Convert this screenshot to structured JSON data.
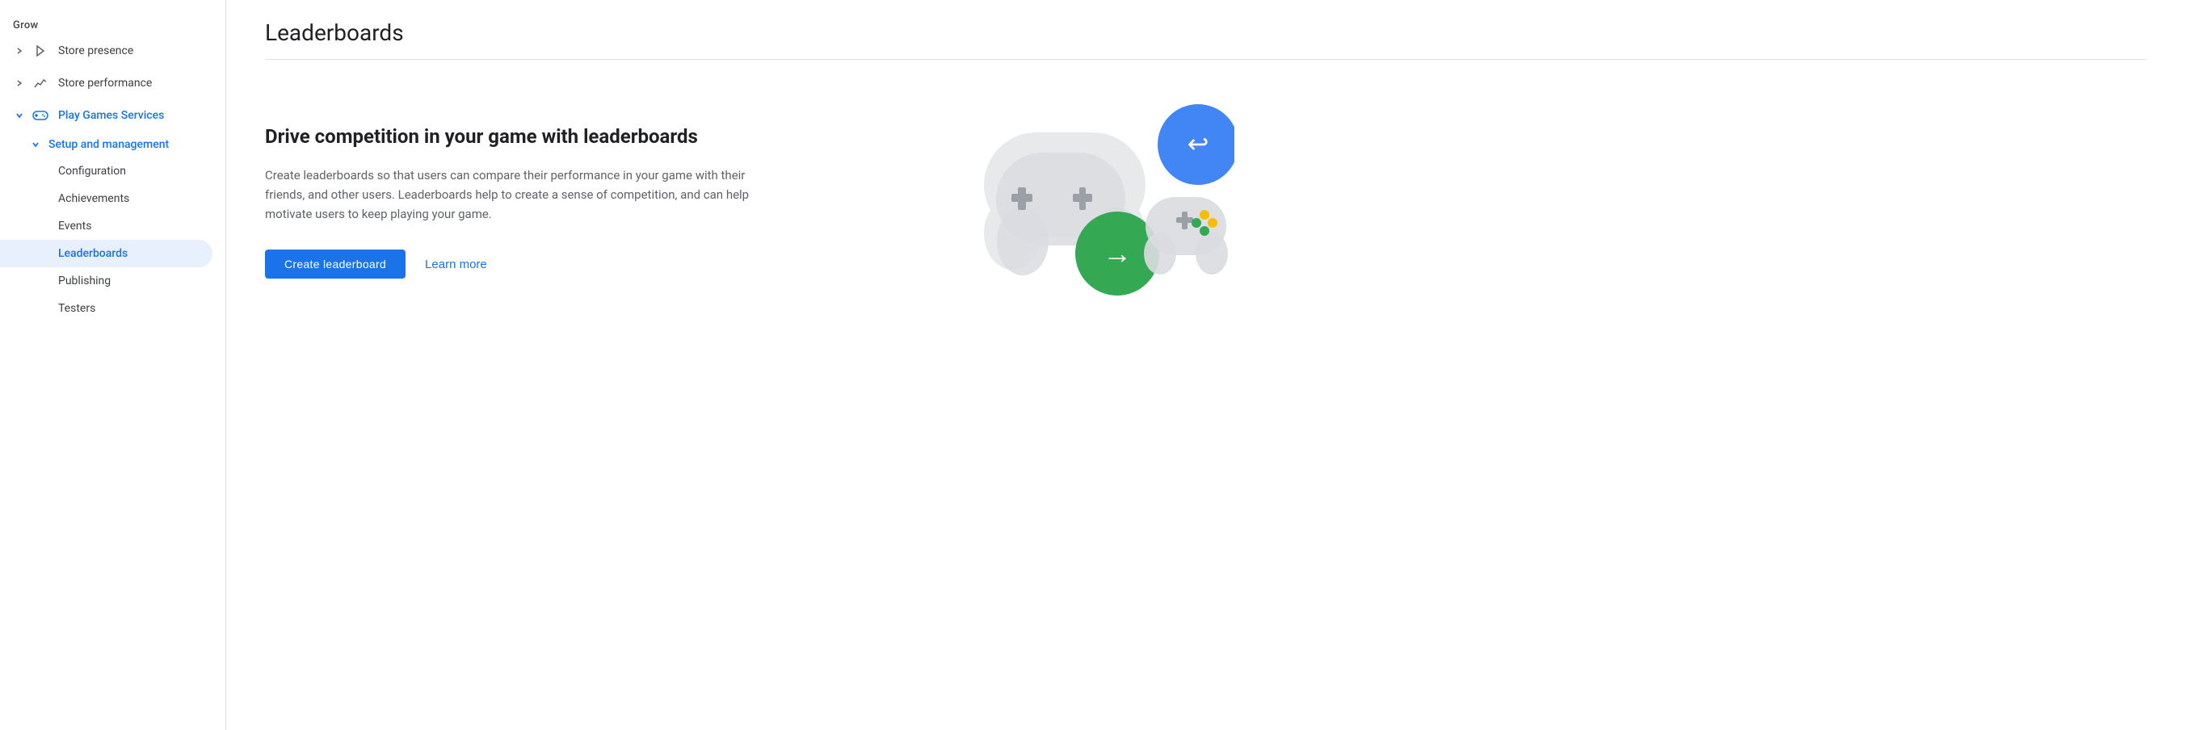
{
  "sidebar": {
    "grow_label": "Grow",
    "items": [
      {
        "id": "store-presence",
        "label": "Store presence",
        "icon": "play-triangle-icon",
        "expanded": false,
        "active": false
      },
      {
        "id": "store-performance",
        "label": "Store performance",
        "icon": "trending-up-icon",
        "expanded": false,
        "active": false
      },
      {
        "id": "play-games-services",
        "label": "Play Games Services",
        "icon": "gamepad-icon",
        "expanded": true,
        "active": true,
        "submenu": {
          "label": "Setup and management",
          "expanded": true,
          "items": [
            {
              "id": "configuration",
              "label": "Configuration",
              "active": false
            },
            {
              "id": "achievements",
              "label": "Achievements",
              "active": false
            },
            {
              "id": "events",
              "label": "Events",
              "active": false
            },
            {
              "id": "leaderboards",
              "label": "Leaderboards",
              "active": true
            },
            {
              "id": "publishing",
              "label": "Publishing",
              "active": false
            },
            {
              "id": "testers",
              "label": "Testers",
              "active": false
            }
          ]
        }
      }
    ]
  },
  "main": {
    "page_title": "Leaderboards",
    "drive_title": "Drive competition in your game with leaderboards",
    "drive_description": "Create leaderboards so that users can compare their performance in your game with their friends, and other users. Leaderboards help to create a sense of competition, and can help motivate users to keep playing your game.",
    "create_button_label": "Create leaderboard",
    "learn_more_label": "Learn more"
  }
}
